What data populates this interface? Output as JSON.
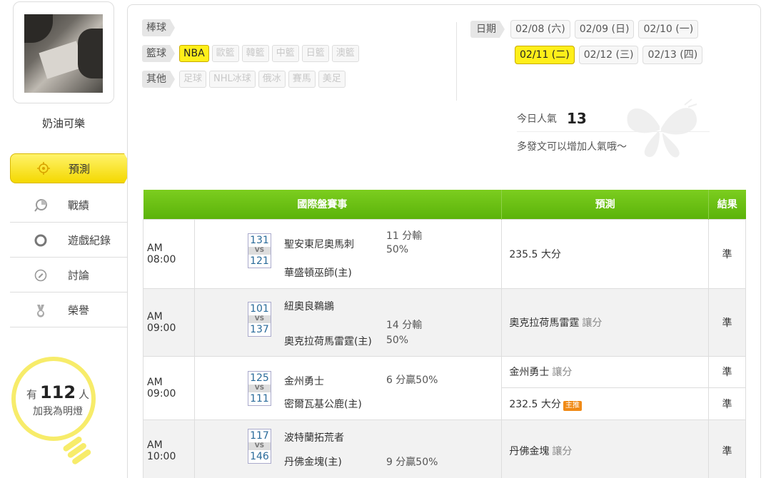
{
  "profile": {
    "username": "奶油可樂"
  },
  "menu": [
    {
      "label": "預測"
    },
    {
      "label": "戰績"
    },
    {
      "label": "遊戲紀錄"
    },
    {
      "label": "討論"
    },
    {
      "label": "榮譽"
    }
  ],
  "fans": {
    "prefix": "有",
    "count": "112",
    "suffix": "人",
    "line2": "加我為明燈"
  },
  "categories": {
    "baseball": {
      "label": "棒球"
    },
    "basketball": {
      "label": "籃球",
      "items": [
        "NBA",
        "歐籃",
        "韓籃",
        "中籃",
        "日籃",
        "澳籃"
      ],
      "active": "NBA"
    },
    "other": {
      "label": "其他",
      "items": [
        "足球",
        "NHL冰球",
        "俄冰",
        "賽馬",
        "美足"
      ]
    }
  },
  "dates": {
    "label": "日期",
    "row1": [
      "02/08 (六)",
      "02/09 (日)",
      "02/10 (一)"
    ],
    "row2": [
      "02/11 (二)",
      "02/12 (三)",
      "02/13 (四)"
    ],
    "active": "02/11 (二)"
  },
  "popularity": {
    "label": "今日人氣",
    "value": "13",
    "hint": "多發文可以增加人氣哦～"
  },
  "table": {
    "headers": {
      "match": "國際盤賽事",
      "pick": "預測",
      "result": "結果"
    },
    "vs": "VS",
    "rows": [
      {
        "time": "AM 08:00",
        "away_score": "131",
        "home_score": "121",
        "away": "聖安東尼奧馬刺",
        "home": "華盛頓巫師(主)",
        "odds1": "11 分輸",
        "odds2": "50%",
        "picks": [
          {
            "text": "235.5 大分",
            "extra": "",
            "result": "準"
          }
        ]
      },
      {
        "time": "AM 09:00",
        "away_score": "101",
        "home_score": "137",
        "away": "紐奧良鵜鶘",
        "home": "奧克拉荷馬雷霆(主)",
        "odds1": "14 分輸",
        "odds2": "50%",
        "picks": [
          {
            "text": "奧克拉荷馬雷霆",
            "extra": "讓分",
            "result": "準"
          }
        ]
      },
      {
        "time": "AM 09:00",
        "away_score": "125",
        "home_score": "111",
        "away": "金州勇士",
        "home": "密爾瓦基公鹿(主)",
        "odds1": "6 分贏50%",
        "odds2": "",
        "picks": [
          {
            "text": "金州勇士",
            "extra": "讓分",
            "result": "準"
          },
          {
            "text": "232.5 大分",
            "extra": "",
            "tag": "主推",
            "result": "準"
          }
        ]
      },
      {
        "time": "AM 10:00",
        "away_score": "117",
        "home_score": "146",
        "away": "波特蘭拓荒者",
        "home": "丹佛金塊(主)",
        "odds1": "9 分贏50%",
        "odds2": "",
        "picks": [
          {
            "text": "丹佛金塊",
            "extra": "讓分",
            "result": "準"
          }
        ]
      }
    ]
  }
}
